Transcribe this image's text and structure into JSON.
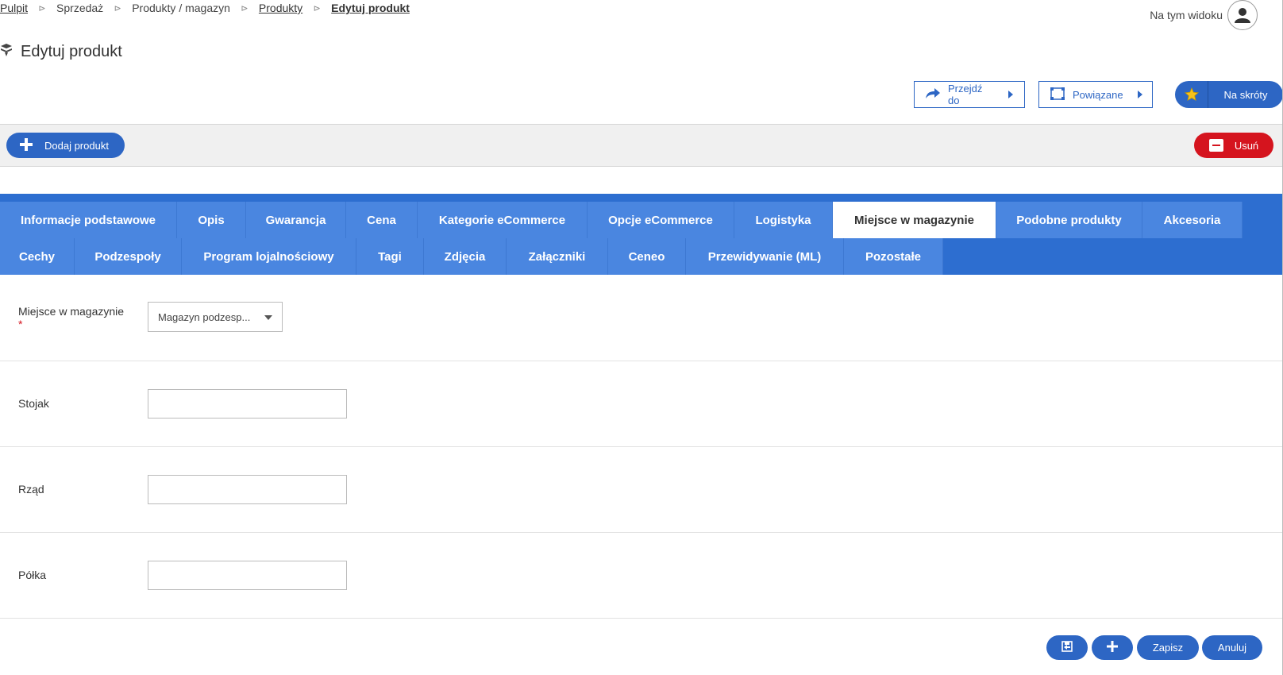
{
  "breadcrumb": {
    "items": [
      {
        "label": "Pulpit"
      },
      {
        "label": "Sprzedaż"
      },
      {
        "label": "Produkty / magazyn"
      },
      {
        "label": "Produkty"
      },
      {
        "label": "Edytuj produkt"
      }
    ]
  },
  "header": {
    "view_label": "Na tym widoku",
    "title": "Edytuj produkt",
    "title_icon": "product-icon"
  },
  "actions": {
    "goto_label": "Przejdź do",
    "related_label": "Powiązane",
    "shortcuts_label": "Na skróty"
  },
  "toolbar": {
    "add_label": "Dodaj produkt",
    "delete_label": "Usuń"
  },
  "tabs": {
    "row1": [
      "Informacje podstawowe",
      "Opis",
      "Gwarancja",
      "Cena",
      "Kategorie eCommerce",
      "Opcje eCommerce",
      "Logistyka",
      "Miejsce w magazynie",
      "Podobne produkty",
      "Akcesoria"
    ],
    "row2": [
      "Cechy",
      "Podzespoły",
      "Program lojalnościowy",
      "Tagi",
      "Zdjęcia",
      "Załączniki",
      "Ceneo",
      "Przewidywanie (ML)",
      "Pozostałe"
    ],
    "active": "Miejsce w magazynie"
  },
  "form": {
    "location_label": "Miejsce w magazynie",
    "required_mark": "*",
    "location_value": "Magazyn podzesp...",
    "rack_label": "Stojak",
    "rack_value": "",
    "row_label": "Rząd",
    "row_value": "",
    "shelf_label": "Półka",
    "shelf_value": ""
  },
  "footer": {
    "save_label": "Zapisz",
    "cancel_label": "Anuluj"
  },
  "colors": {
    "primary": "#2d66c4",
    "tabs_bg": "#2d6ed0",
    "tab_bg": "#4a86e0",
    "danger": "#d5141e"
  }
}
